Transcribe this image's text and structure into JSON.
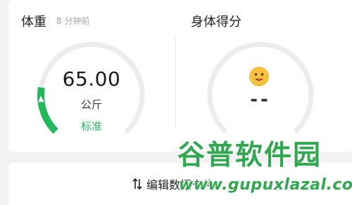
{
  "weight_panel": {
    "title": "体重",
    "timestamp": "8 分钟前",
    "value": "65.00",
    "unit": "公斤",
    "status": "标准",
    "gauge_level": 0.2
  },
  "score_panel": {
    "title": "身体得分",
    "value": "--",
    "emoji_icon": "smiley-face-icon"
  },
  "actions": {
    "edit_label": "编辑数据卡片",
    "edit_icon": "sort-arrows-icon"
  },
  "watermark": {
    "title": "谷普软件园",
    "url": "www.gupuxlazal.com"
  },
  "colors": {
    "accent_green": "#22b85c",
    "track_gray": "#ececec",
    "emoji_yellow": "#f5c13c"
  }
}
